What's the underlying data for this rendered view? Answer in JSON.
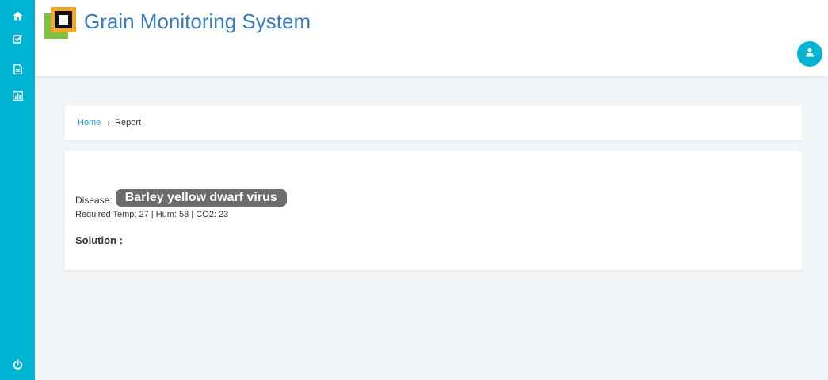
{
  "app": {
    "title": "Grain Monitoring System"
  },
  "sidebar": {
    "items": [
      {
        "icon": "home-icon"
      },
      {
        "icon": "check-square-icon"
      },
      {
        "icon": "document-icon"
      },
      {
        "icon": "bar-chart-icon"
      }
    ],
    "bottom_icon": "power-icon"
  },
  "header": {
    "user_icon": "user-icon"
  },
  "breadcrumb": {
    "home": "Home",
    "separator": "›",
    "current": "Report"
  },
  "report": {
    "disease_label": "Disease:",
    "disease_value": "Barley yellow dwarf virus",
    "requirements": "Required Temp: 27 | Hum: 58 | CO2: 23",
    "solution_label": "Solution :"
  },
  "colors": {
    "accent": "#00b4d4",
    "title": "#3a7bbd",
    "link": "#1aa3c8",
    "badge": "#6c6c6c",
    "background": "#f2f5f7"
  }
}
